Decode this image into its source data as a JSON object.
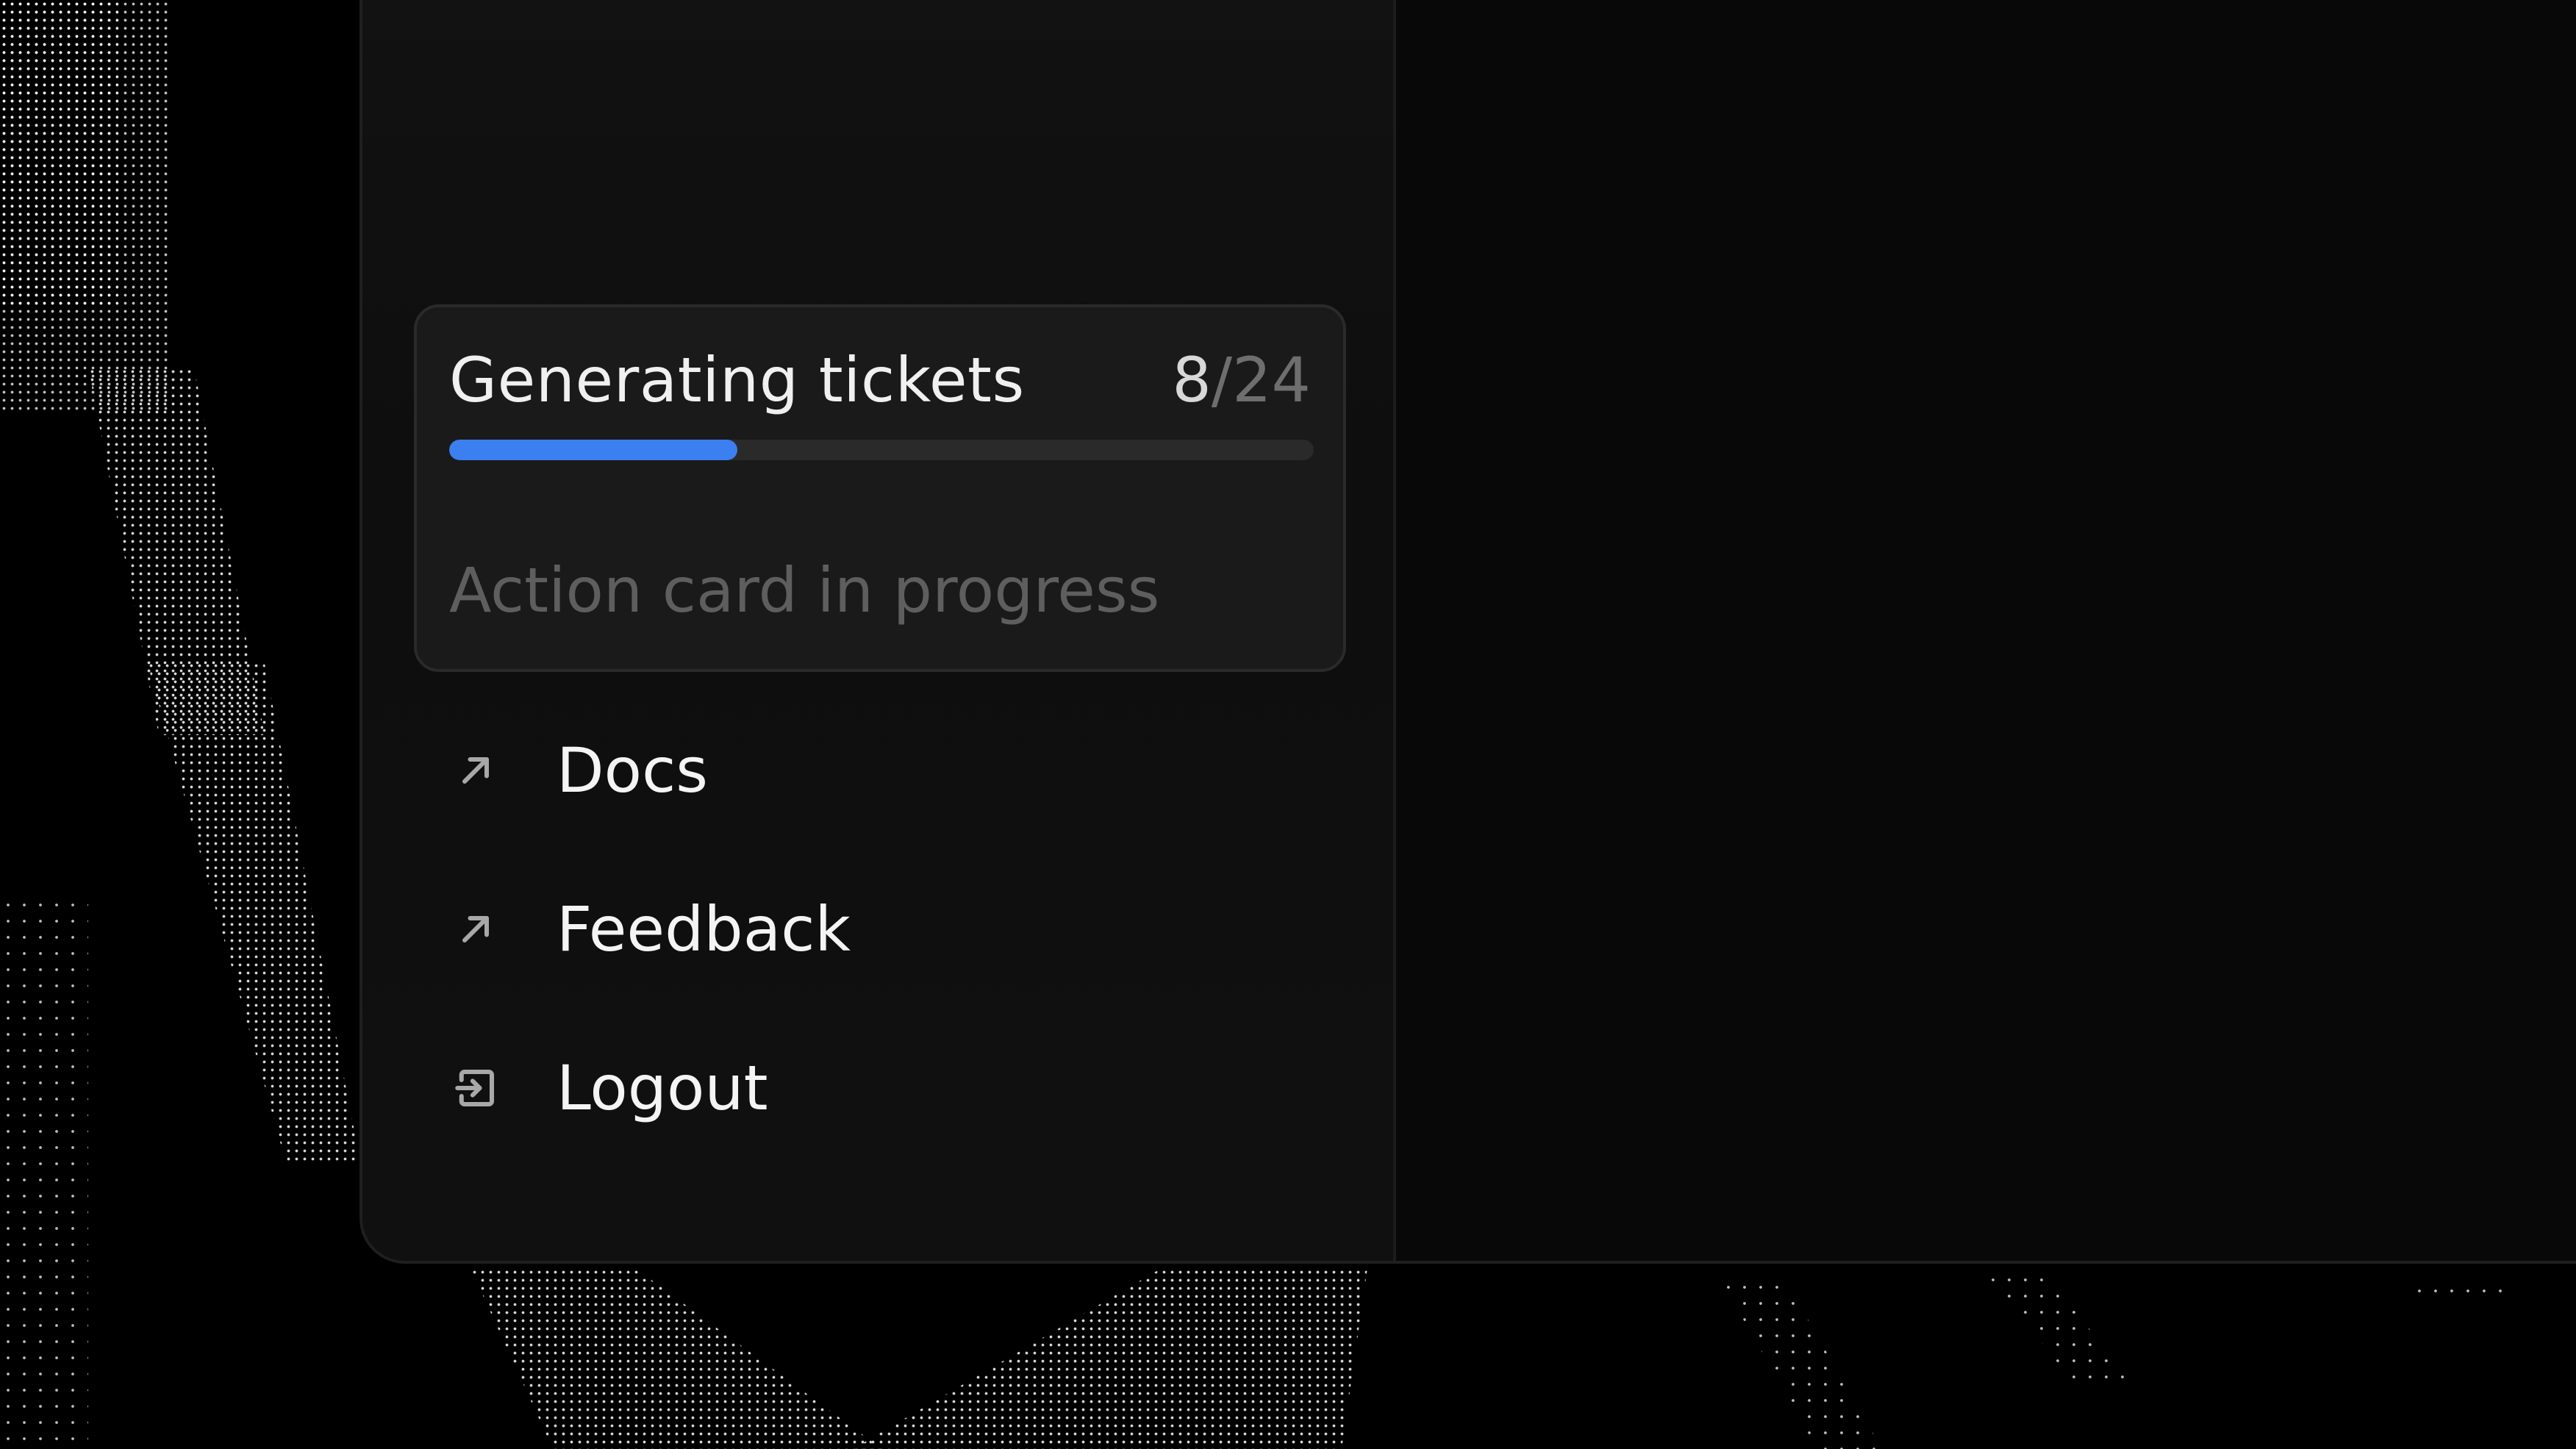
{
  "progress_card": {
    "title": "Generating tickets",
    "count_current": "8",
    "count_separator": "/",
    "count_total": "24",
    "progress_fraction": 0.333,
    "status": "Action card in progress",
    "accent_color": "#3b7ff0"
  },
  "nav": {
    "items": [
      {
        "label": "Docs",
        "icon": "arrow-up-right-icon"
      },
      {
        "label": "Feedback",
        "icon": "arrow-up-right-icon"
      },
      {
        "label": "Logout",
        "icon": "logout-icon"
      }
    ]
  }
}
